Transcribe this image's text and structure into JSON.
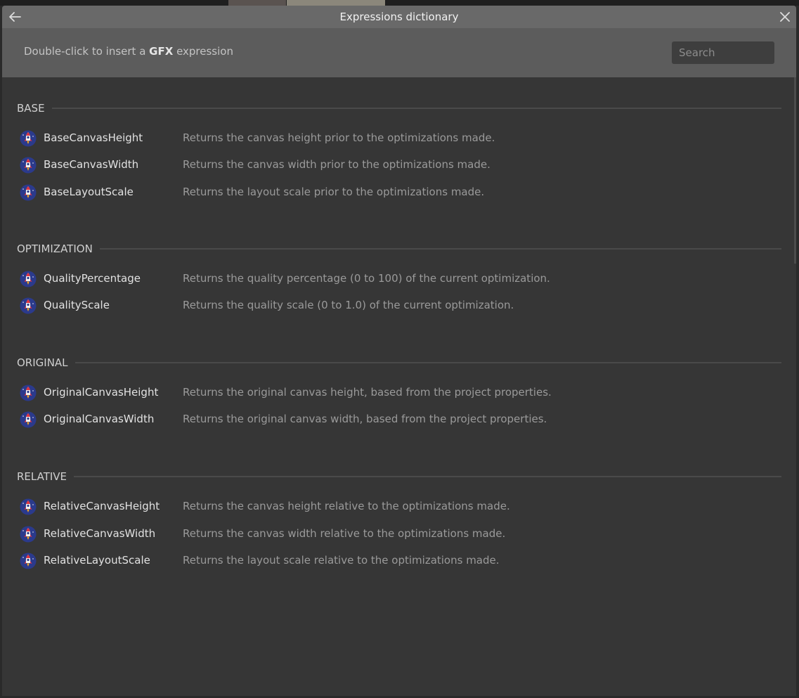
{
  "window": {
    "title": "Expressions dictionary",
    "back_icon": "arrow-left-icon",
    "close_icon": "close-icon"
  },
  "header": {
    "hint_prefix": "Double-click to insert a ",
    "hint_bold": "GFX",
    "hint_suffix": " expression",
    "search_placeholder": "Search",
    "search_value": ""
  },
  "colors": {
    "title_bar": "#696969",
    "header_bg": "#5c5c5c",
    "body_bg": "#363636",
    "icon_bg": "#2b3a8c",
    "icon_accent": "#e0343f"
  },
  "sections": [
    {
      "title": "BASE",
      "items": [
        {
          "name": "BaseCanvasHeight",
          "desc": "Returns the canvas height prior to the optimizations made.",
          "icon": "rocket-icon"
        },
        {
          "name": "BaseCanvasWidth",
          "desc": "Returns the canvas width prior to the optimizations made.",
          "icon": "rocket-icon"
        },
        {
          "name": "BaseLayoutScale",
          "desc": "Returns the layout scale prior to the optimizations made.",
          "icon": "rocket-icon"
        }
      ]
    },
    {
      "title": "OPTIMIZATION",
      "items": [
        {
          "name": "QualityPercentage",
          "desc": "Returns the quality percentage (0 to 100) of the current optimization.",
          "icon": "rocket-icon"
        },
        {
          "name": "QualityScale",
          "desc": "Returns the quality scale (0 to 1.0) of the current optimization.",
          "icon": "rocket-icon"
        }
      ]
    },
    {
      "title": "ORIGINAL",
      "items": [
        {
          "name": "OriginalCanvasHeight",
          "desc": "Returns the original canvas height, based from the project properties.",
          "icon": "rocket-icon"
        },
        {
          "name": "OriginalCanvasWidth",
          "desc": "Returns the original canvas width, based from the project properties.",
          "icon": "rocket-icon"
        }
      ]
    },
    {
      "title": "RELATIVE",
      "items": [
        {
          "name": "RelativeCanvasHeight",
          "desc": "Returns the canvas height relative to the optimizations made.",
          "icon": "rocket-icon"
        },
        {
          "name": "RelativeCanvasWidth",
          "desc": "Returns the canvas width relative to the optimizations made.",
          "icon": "rocket-icon"
        },
        {
          "name": "RelativeLayoutScale",
          "desc": "Returns the layout scale relative to the optimizations made.",
          "icon": "rocket-icon"
        }
      ]
    }
  ]
}
